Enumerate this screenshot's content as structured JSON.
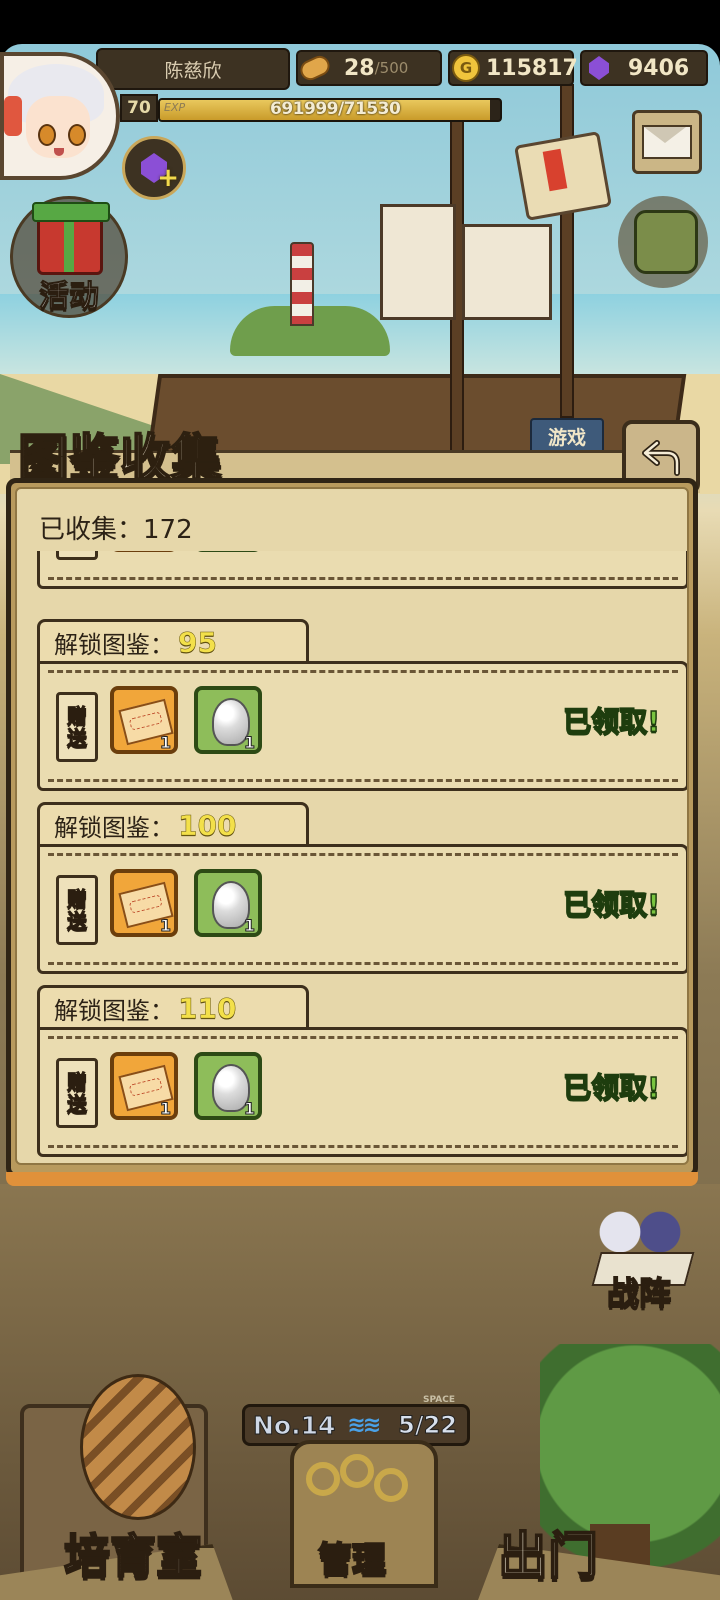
{
  "player": {
    "name": "陈慈欣",
    "level": "70",
    "exp_label": "EXP",
    "exp_text": "691999/71530",
    "exp_progress": 0.97
  },
  "resources": {
    "stamina": {
      "value": "28",
      "max": "/500",
      "icon": "bread-icon"
    },
    "gold": {
      "value": "115817",
      "icon": "gold-coin-icon",
      "coin_letter": "G"
    },
    "gems": {
      "value": "9406",
      "icon": "purple-gem-icon"
    }
  },
  "side_buttons": {
    "activity_label": "活动",
    "game_sign": "游戏"
  },
  "panel": {
    "title": "图鉴收集",
    "collected_text": "已收集：172",
    "entries": [
      {
        "prefix": "解锁图鉴：",
        "milestone": "95",
        "gift_tag": [
          "赠",
          "送"
        ],
        "rewards": [
          {
            "icon": "ticket-icon",
            "qty": "1"
          },
          {
            "icon": "silver-slime-icon",
            "qty": "1"
          }
        ],
        "status": "已领取!"
      },
      {
        "prefix": "解锁图鉴：",
        "milestone": "100",
        "gift_tag": [
          "赠",
          "送"
        ],
        "rewards": [
          {
            "icon": "ticket-icon",
            "qty": "1"
          },
          {
            "icon": "silver-slime-icon",
            "qty": "1"
          }
        ],
        "status": "已领取!"
      },
      {
        "prefix": "解锁图鉴：",
        "milestone": "110",
        "gift_tag": [
          "赠",
          "送"
        ],
        "rewards": [
          {
            "icon": "ticket-icon",
            "qty": "1"
          },
          {
            "icon": "silver-slime-icon",
            "qty": "1"
          }
        ],
        "status": "已领取!"
      }
    ]
  },
  "bottom": {
    "battle_label": "战阵",
    "floor_no": "No.14",
    "floor_space_label": "SPACE",
    "floor_count": "5/22",
    "nav": {
      "nursery": "培育室",
      "manage": "管理",
      "exit": "出门"
    }
  },
  "colors": {
    "panel_bg": "#e6d7aa",
    "milestone_yellow": "#f3e04a",
    "claimed_green": "#79c440",
    "ticket_frame": "#f1a63a",
    "slime_frame": "#8ebd5a"
  }
}
